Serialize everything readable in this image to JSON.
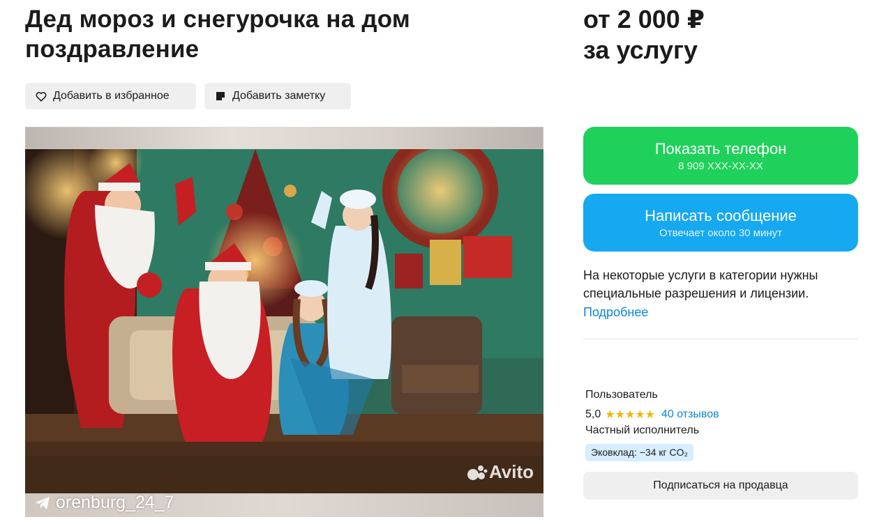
{
  "listing": {
    "title": "Дед мороз и снегурочка на дом поздравление",
    "price_line1": "от 2 000 ₽",
    "price_line2": "за услугу"
  },
  "actions": {
    "favorite_label": "Добавить в избранное",
    "note_label": "Добавить заметку"
  },
  "photo": {
    "watermark": "Avito",
    "telegram_handle": "orenburg_24_7"
  },
  "contact": {
    "phone_label": "Показать телефон",
    "phone_masked": "8 909 XXX-XX-XX",
    "message_label": "Написать сообщение",
    "message_sub": "Отвечает около 30 минут"
  },
  "notice": {
    "text": "На некоторые услуги в категории нужны специальные разрешения и лицензии.",
    "link": "Подробнее"
  },
  "seller": {
    "name": "Пользователь",
    "rating": "5,0",
    "stars": "★★★★★",
    "reviews": "40 отзывов",
    "type": "Частный исполнитель",
    "eco": "Эковклад: −34 кг CO₂",
    "subscribe_label": "Подписаться на продавца"
  },
  "colors": {
    "phone_button": "#1fd15a",
    "message_button": "#16a8f0",
    "link": "#0a87d6",
    "star": "#f5b400"
  }
}
